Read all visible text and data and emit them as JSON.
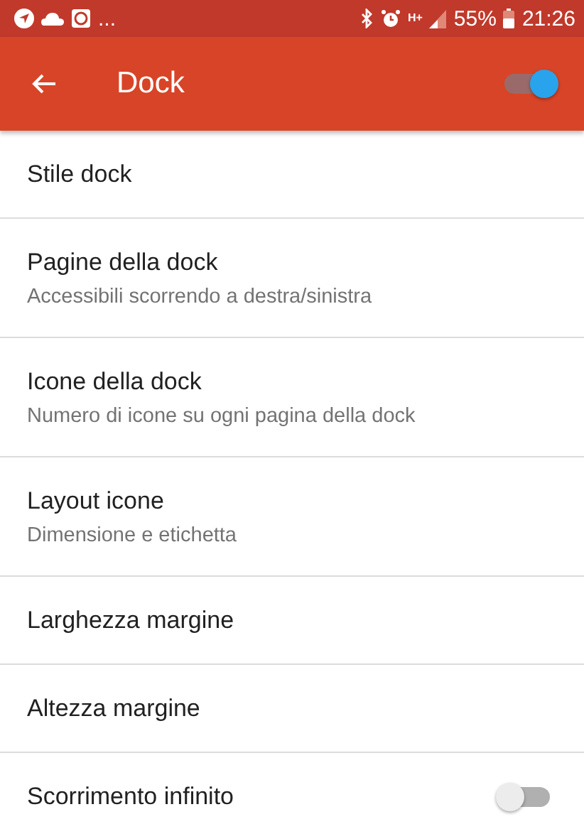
{
  "status_bar": {
    "more": "...",
    "network": "H+",
    "battery": "55%",
    "time": "21:26"
  },
  "app_bar": {
    "title": "Dock",
    "enabled": true
  },
  "items": [
    {
      "kind": "plain",
      "title": "Stile dock"
    },
    {
      "kind": "plain",
      "title": "Pagine della dock",
      "subtitle": "Accessibili scorrendo a destra/sinistra"
    },
    {
      "kind": "plain",
      "title": "Icone della dock",
      "subtitle": "Numero di icone su ogni pagina della dock"
    },
    {
      "kind": "plain",
      "title": "Layout icone",
      "subtitle": "Dimensione e etichetta"
    },
    {
      "kind": "plain",
      "title": "Larghezza margine"
    },
    {
      "kind": "plain",
      "title": "Altezza margine"
    },
    {
      "kind": "switch",
      "title": "Scorrimento infinito",
      "on": false
    }
  ]
}
